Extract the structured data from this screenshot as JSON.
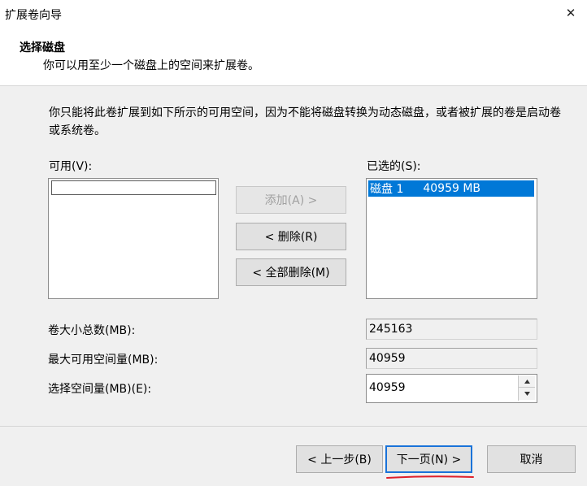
{
  "window": {
    "title": "扩展卷向导",
    "close_glyph": "✕"
  },
  "header": {
    "title": "选择磁盘",
    "subtitle": "你可以用至少一个磁盘上的空间来扩展卷。"
  },
  "description": "你只能将此卷扩展到如下所示的可用空间，因为不能将磁盘转换为动态磁盘，或者被扩展的卷是启动卷或系统卷。",
  "available": {
    "label": "可用(V):",
    "items": []
  },
  "buttons": {
    "add": "添加(A) >",
    "remove": "< 删除(R)",
    "remove_all": "< 全部删除(M)"
  },
  "selected": {
    "label": "已选的(S):",
    "items": [
      {
        "disk": "磁盘 1",
        "size": "40959 MB"
      }
    ]
  },
  "fields": {
    "total_label": "卷大小总数(MB):",
    "total_value": "245163",
    "max_label": "最大可用空间量(MB):",
    "max_value": "40959",
    "select_label": "选择空间量(MB)(E):",
    "select_value": "40959"
  },
  "footer": {
    "back": "< 上一步(B)",
    "next": "下一页(N) >",
    "cancel": "取消"
  },
  "colors": {
    "selection": "#0078d7",
    "annotation_underline": "#e0202a",
    "primary_border": "#1a73d9"
  }
}
